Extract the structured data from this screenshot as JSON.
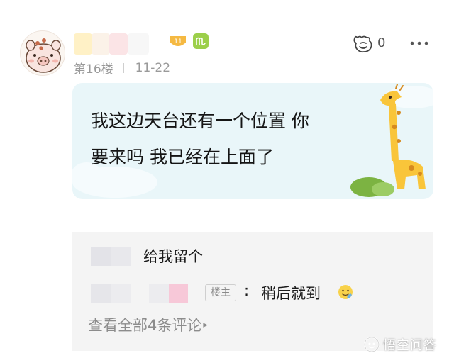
{
  "post": {
    "floor": "第16楼",
    "date": "11-22",
    "like_count": "0",
    "bubble_line1": "我这边天台还有一个位置 你",
    "bubble_line2": "要来吗 我已经在上面了",
    "level_badge": "11"
  },
  "replies": {
    "reply1_text": "给我留个",
    "author_tag": "楼主",
    "colon": ":",
    "reply2_text": "稍后就到",
    "view_all": "查看全部4条评论"
  },
  "watermark": {
    "text": "悟空问答"
  },
  "icons": {
    "avatar": "pig-avatar",
    "zodiac": "virgo-icon",
    "like": "like-icon",
    "more": "more-icon",
    "emoji": "thumbs-up-emoji"
  },
  "colors": {
    "bubble_bg": "#e9f6f9",
    "comments_bg": "#f4f4f4",
    "zodiac_green": "#9ccf4a",
    "level_gold": "#f5b942"
  }
}
